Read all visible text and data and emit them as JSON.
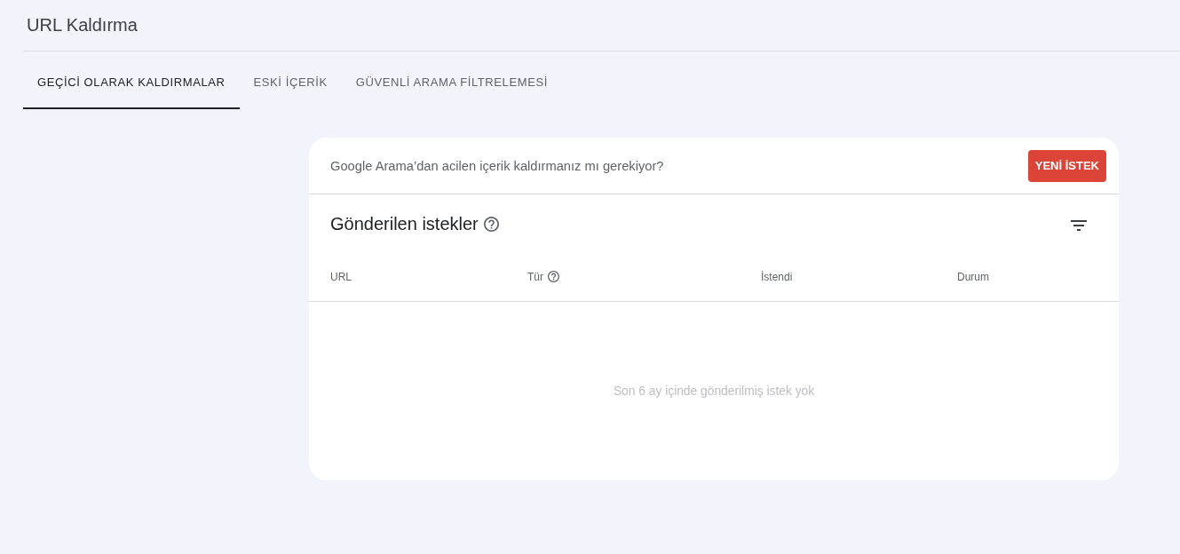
{
  "page": {
    "title": "URL Kaldırma"
  },
  "tabs": [
    {
      "label": "GEÇİCİ OLARAK KALDIRMALAR",
      "selected": true
    },
    {
      "label": "ESKİ İÇERİK",
      "selected": false
    },
    {
      "label": "GÜVENLİ ARAMA FİLTRELEMESİ",
      "selected": false
    }
  ],
  "notice": {
    "text": "Google Arama’dan acilen içerik kaldırmanız mı gerekiyor?",
    "button": "YENİ İSTEK"
  },
  "requests": {
    "title": "Gönderilen istekler",
    "columns": [
      {
        "label": "URL",
        "help": false
      },
      {
        "label": "Tür",
        "help": true
      },
      {
        "label": "İstendi",
        "help": false
      },
      {
        "label": "Durum",
        "help": false
      }
    ],
    "empty_message": "Son 6 ay içinde gönderilmiş istek yok"
  }
}
